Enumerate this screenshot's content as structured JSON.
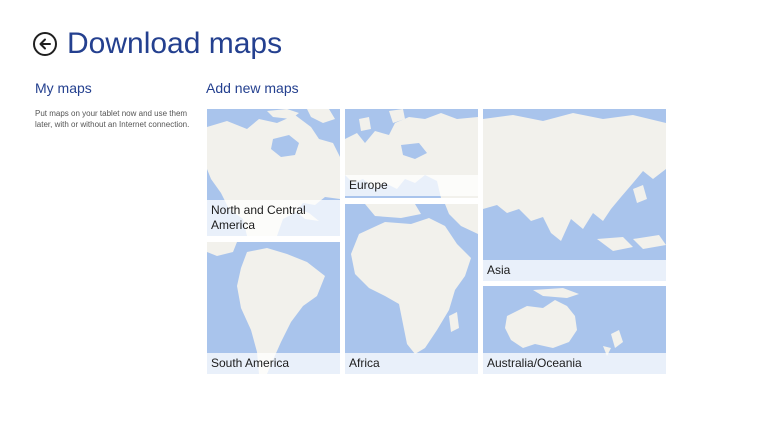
{
  "header": {
    "title": "Download maps"
  },
  "my_maps": {
    "heading": "My maps",
    "description": "Put maps on your tablet now and use them later, with or without an Internet connection."
  },
  "add_maps": {
    "heading": "Add new maps",
    "regions": [
      {
        "label": "North and Central America"
      },
      {
        "label": "Europe"
      },
      {
        "label": "Asia"
      },
      {
        "label": "South America"
      },
      {
        "label": "Africa"
      },
      {
        "label": "Australia/Oceania"
      }
    ]
  },
  "colors": {
    "accent": "#24408f",
    "water": "#a9c4ec",
    "land": "#f2f1ec",
    "label_bg": "#ffffff"
  }
}
